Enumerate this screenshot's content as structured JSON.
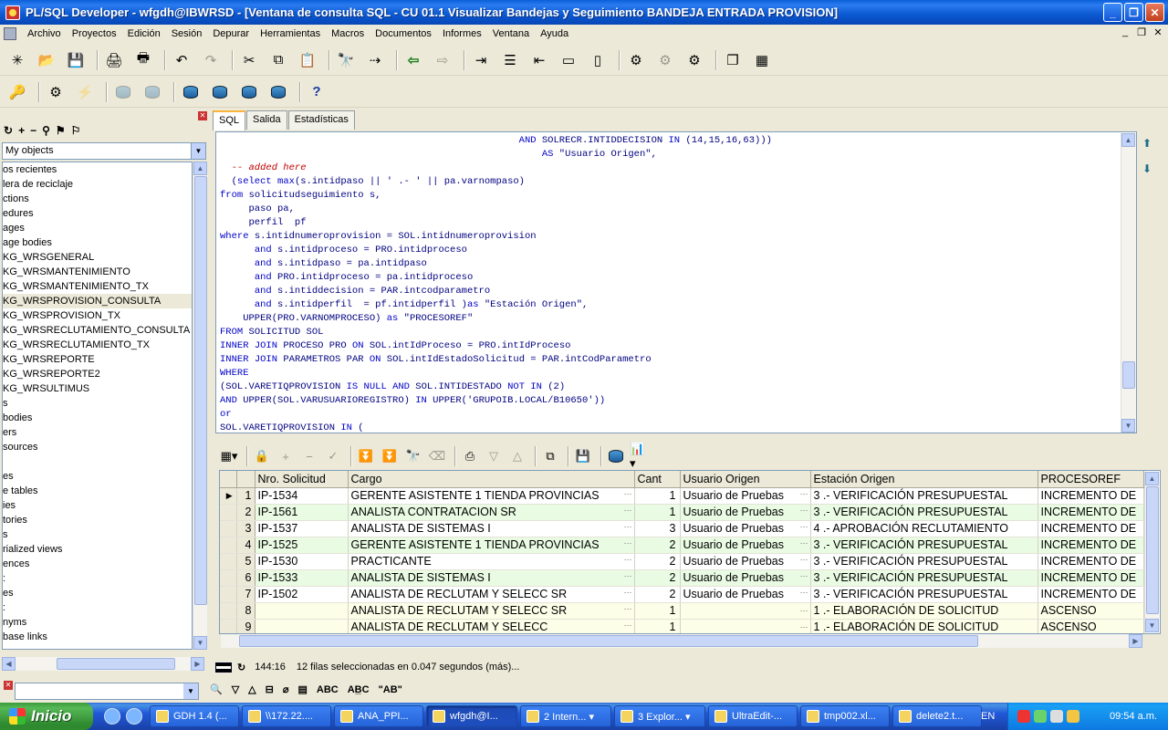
{
  "window": {
    "title": "PL/SQL Developer - wfgdh@IBWRSD - [Ventana de consulta SQL - CU 01.1 Visualizar Bandejas y Seguimiento BANDEJA ENTRADA PROVISION]",
    "buttons": [
      "_",
      "❐",
      "✕"
    ]
  },
  "menu": [
    "Archivo",
    "Proyectos",
    "Edición",
    "Sesión",
    "Depurar",
    "Herramientas",
    "Macros",
    "Documentos",
    "Informes",
    "Ventana",
    "Ayuda"
  ],
  "mdi_controls": [
    "_",
    "❐",
    "✕"
  ],
  "left_panel": {
    "selector_value": "My objects",
    "tree_items": [
      "os recientes",
      "lera de reciclaje",
      "ctions",
      "edures",
      "ages",
      "age bodies",
      "KG_WRSGENERAL",
      "KG_WRSMANTENIMIENTO",
      "KG_WRSMANTENIMIENTO_TX",
      "KG_WRSPROVISION_CONSULTA",
      "KG_WRSPROVISION_TX",
      "KG_WRSRECLUTAMIENTO_CONSULTA",
      "KG_WRSRECLUTAMIENTO_TX",
      "KG_WRSREPORTE",
      "KG_WRSREPORTE2",
      "KG_WRSULTIMUS",
      "s",
      " bodies",
      "ers",
      " sources",
      "",
      "es",
      "e tables",
      "ies",
      "tories",
      "s",
      "rialized views",
      "ences",
      ":",
      "es",
      ":",
      "nyms",
      "base links"
    ],
    "selected_index": 9
  },
  "editor": {
    "tabs": [
      "SQL",
      "Salida",
      "Estadísticas"
    ],
    "active_tab": "SQL",
    "code_lines": [
      "                                                    AND SOLRECR.INTIDDECISION IN (14,15,16,63)))",
      "                                                        AS \"Usuario Origen\",",
      "  -- added here",
      "  (select max(s.intidpaso || ' .- ' || pa.varnompaso)",
      "from solicitudseguimiento s,",
      "     paso pa,",
      "     perfil  pf",
      "where s.intidnumeroprovision = SOL.intidnumeroprovision",
      "      and s.intidproceso = PRO.intidproceso",
      "      and s.intidpaso = pa.intidpaso",
      "      and PRO.intidproceso = pa.intidproceso",
      "      and s.intiddecision = PAR.intcodparametro",
      "      and s.intidperfil  = pf.intidperfil )as \"Estación Origen\",",
      "    UPPER(PRO.VARNOMPROCESO) as \"PROCESOREF\"",
      "FROM SOLICITUD SOL",
      "INNER JOIN PROCESO PRO ON SOL.intIdProceso = PRO.intIdProceso",
      "INNER JOIN PARAMETROS PAR ON SOL.intIdEstadoSolicitud = PAR.intCodParametro",
      "WHERE",
      "(SOL.VARETIQPROVISION IS NULL AND SOL.INTIDESTADO NOT IN (2)",
      "AND UPPER(SOL.VARUSUARIOREGISTRO) IN UPPER('GRUPOIB.LOCAL/B10650'))",
      "or",
      "SOL.VARETIQPROVISION IN ("
    ]
  },
  "grid": {
    "columns": [
      "Nro. Solicitud",
      "Cargo",
      "Cant",
      "Usuario Origen",
      "Estación Origen",
      "PROCESOREF"
    ],
    "rows": [
      [
        "1",
        "IP-1534",
        "GERENTE ASISTENTE 1 TIENDA PROVINCIAS",
        "1",
        "Usuario de Pruebas",
        "3 .- VERIFICACIÓN PRESUPUESTAL",
        "INCREMENTO DE"
      ],
      [
        "2",
        "IP-1561",
        "ANALISTA CONTRATACION SR",
        "1",
        "Usuario de Pruebas",
        "3 .- VERIFICACIÓN PRESUPUESTAL",
        "INCREMENTO DE"
      ],
      [
        "3",
        "IP-1537",
        "ANALISTA DE SISTEMAS I",
        "3",
        "Usuario de Pruebas",
        "4 .- APROBACIÓN RECLUTAMIENTO",
        "INCREMENTO DE"
      ],
      [
        "4",
        "IP-1525",
        "GERENTE ASISTENTE 1 TIENDA PROVINCIAS",
        "2",
        "Usuario de Pruebas",
        "3 .- VERIFICACIÓN PRESUPUESTAL",
        "INCREMENTO DE"
      ],
      [
        "5",
        "IP-1530",
        "PRACTICANTE",
        "2",
        "Usuario de Pruebas",
        "3 .- VERIFICACIÓN PRESUPUESTAL",
        "INCREMENTO DE"
      ],
      [
        "6",
        "IP-1533",
        "ANALISTA DE SISTEMAS I",
        "2",
        "Usuario de Pruebas",
        "3 .- VERIFICACIÓN PRESUPUESTAL",
        "INCREMENTO DE"
      ],
      [
        "7",
        "IP-1502",
        "ANALISTA DE RECLUTAM Y SELECC SR",
        "2",
        "Usuario de Pruebas",
        "3 .- VERIFICACIÓN PRESUPUESTAL",
        "INCREMENTO DE"
      ],
      [
        "8",
        "",
        "ANALISTA DE RECLUTAM Y SELECC SR",
        "1",
        "",
        "1 .- ELABORACIÓN DE SOLICITUD",
        "ASCENSO"
      ],
      [
        "9",
        "",
        "ANALISTA DE RECLUTAM Y SELECC",
        "1",
        "",
        "1 .- ELABORACIÓN DE SOLICITUD",
        "ASCENSO"
      ]
    ]
  },
  "status": {
    "position": "144:16",
    "message": "12 filas seleccionadas en 0.047 segundos (más)..."
  },
  "findbar": {
    "tools": [
      "🔍",
      "▽",
      "△",
      "⊟",
      "⌀",
      "▤",
      "ABC",
      "AB̲C",
      "\"AB\""
    ]
  },
  "taskbar": {
    "start_label": "Inicio",
    "tasks": [
      {
        "label": "GDH 1.4 (...",
        "width": 98
      },
      {
        "label": "\\\\172.22....",
        "width": 98
      },
      {
        "label": "ANA_PPI...",
        "width": 98
      },
      {
        "label": "wfgdh@I...",
        "width": 100,
        "active": true
      },
      {
        "label": "2 Intern... ▾",
        "width": 100
      },
      {
        "label": "3 Explor... ▾",
        "width": 100
      },
      {
        "label": "UltraEdit-...",
        "width": 98
      },
      {
        "label": "tmp002.xl...",
        "width": 98
      },
      {
        "label": "delete2.t...",
        "width": 98
      }
    ],
    "lang": "EN",
    "clock": "09:54 a.m."
  }
}
